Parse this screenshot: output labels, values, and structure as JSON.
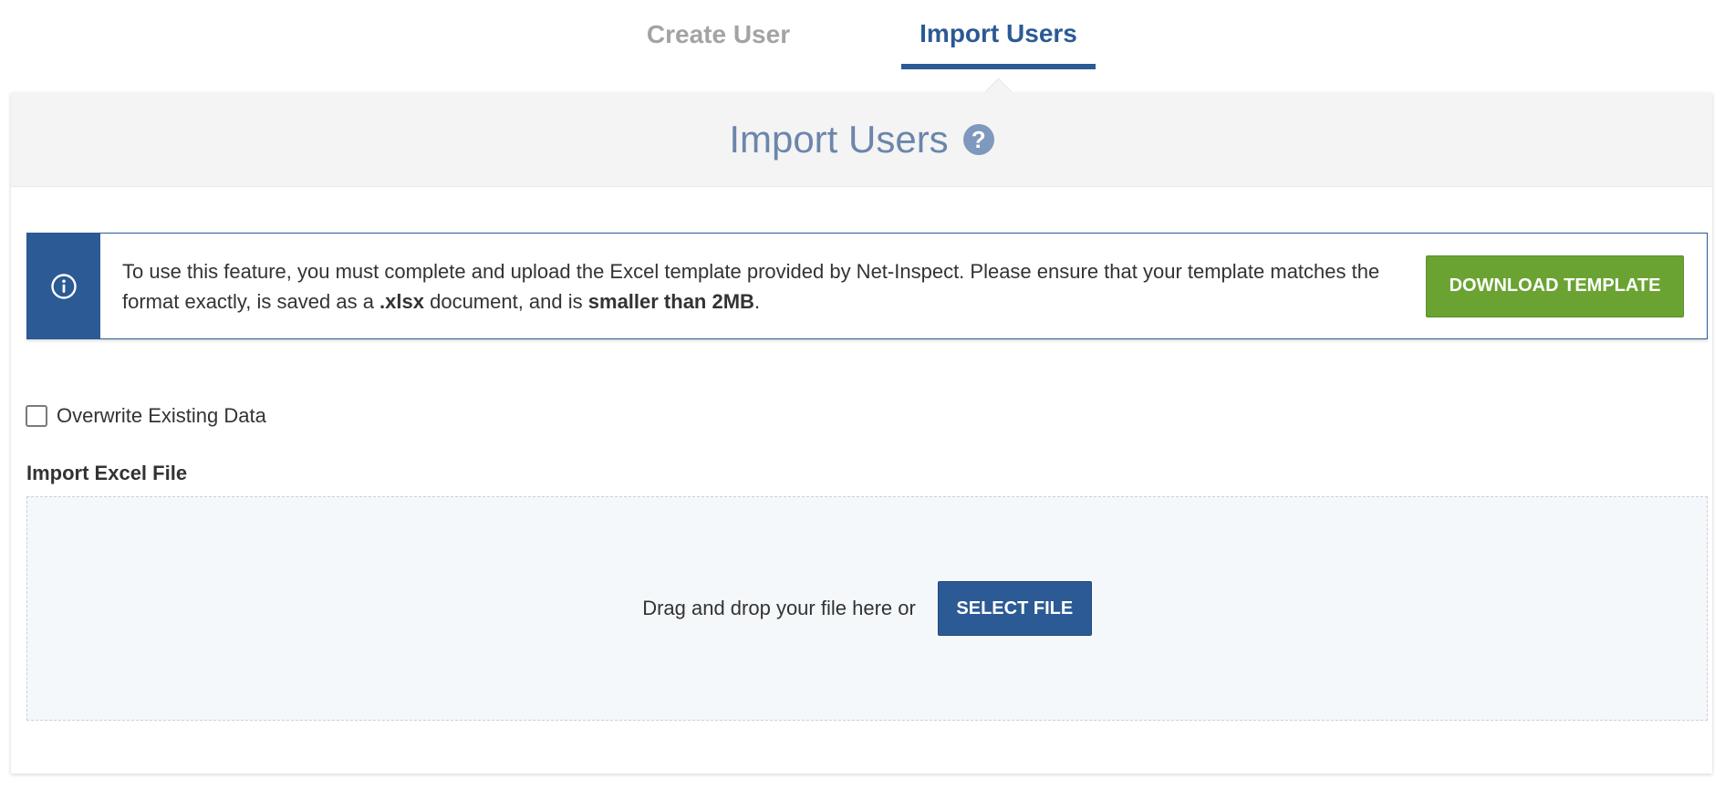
{
  "tabs": {
    "create_label": "Create User",
    "import_label": "Import Users",
    "active": "Import Users"
  },
  "card": {
    "title": "Import Users",
    "help_icon": "?"
  },
  "info": {
    "icon": "info-circle-icon",
    "text_part1": "To use this feature, you must complete and upload the Excel template provided by Net-Inspect. Please ensure that your template matches the format exactly, is saved as a ",
    "text_bold1": ".xlsx",
    "text_part2": " document, and is ",
    "text_bold2": "smaller than 2MB",
    "text_part3": ".",
    "download_label": "DOWNLOAD TEMPLATE"
  },
  "options": {
    "overwrite_label": "Overwrite Existing Data",
    "overwrite_checked": false
  },
  "import": {
    "label": "Import Excel File",
    "drop_text": "Drag and drop your file here or",
    "select_label": "SELECT FILE"
  },
  "colors": {
    "primary": "#2b5a95",
    "success": "#6aa332",
    "inactive_tab": "#a3a3a3",
    "title": "#6c86ab"
  }
}
